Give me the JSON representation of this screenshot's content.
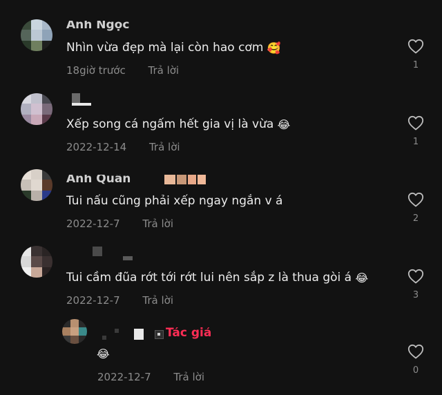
{
  "comments": [
    {
      "username": "Anh Ngọc",
      "text": "Nhìn vừa đẹp mà lại còn hao cơm",
      "emoji": "🥰",
      "date": "18giờ trước",
      "reply_label": "Trả lời",
      "like_count": "1"
    },
    {
      "username": "",
      "text": "Xếp song cá ngấm hết gia vị là vừa",
      "emoji": "😂",
      "date": "2022-12-14",
      "reply_label": "Trả lời",
      "like_count": "1"
    },
    {
      "username": "Anh Quân",
      "text": "Tui nấu cũng phải xếp ngay ngắn v á",
      "emoji": "",
      "date": "2022-12-7",
      "reply_label": "Trả lời",
      "like_count": "2"
    },
    {
      "username": "",
      "text": "Tui cầm đũa rớt tới rớt lui nên sắp z là thua gòi á",
      "emoji": "😂",
      "date": "2022-12-7",
      "reply_label": "Trả lời",
      "like_count": "3"
    }
  ],
  "reply": {
    "author_badge": "Tác giả",
    "emoji": "😂",
    "date": "2022-12-7",
    "reply_label": "Trả lời",
    "like_count": "0"
  },
  "colors": {
    "background": "#121212",
    "author_badge": "#ff2d55",
    "meta_text": "#8c8c8c"
  },
  "icons": [
    "heart-icon"
  ]
}
